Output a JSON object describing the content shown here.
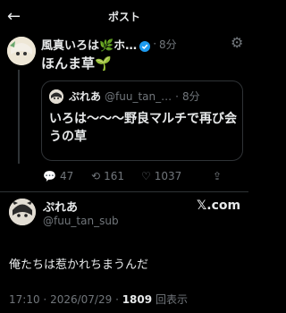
{
  "header": {
    "title": "ポスト"
  },
  "post": {
    "author": "風真いろは🌿ホ…",
    "time_sep": "·",
    "time": "8分",
    "text": "ほんま草🌱"
  },
  "quote": {
    "author": "ぷれあ",
    "handle": "@fuu_tan_…",
    "time_sep": "·",
    "time": "8分",
    "text": "いろは〜〜〜野良マルチで再び会うの草"
  },
  "stats": {
    "replies": "47",
    "reposts": "161",
    "likes": "1037"
  },
  "embed": {
    "author": "ぷれあ",
    "handle": "@fuu_tan_sub",
    "logo": "𝕏.com",
    "text": "俺たちは惹かれちまうんだ"
  },
  "footer": {
    "time": "17:10",
    "date": "2026/07/29",
    "views": "1809",
    "views_label": "回表示"
  }
}
